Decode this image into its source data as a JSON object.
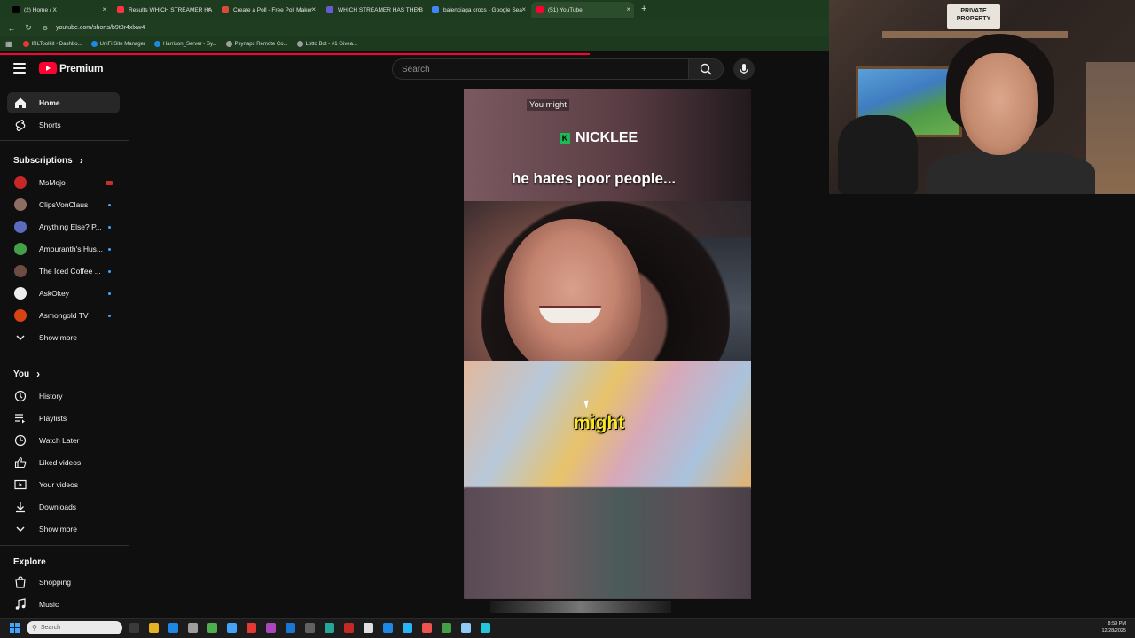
{
  "browser": {
    "tabs": [
      {
        "label": "(2) Home / X",
        "fav_color": "#000000",
        "active": false
      },
      {
        "label": "Results WHICH STREAMER HA",
        "fav_color": "#ff3344",
        "active": false
      },
      {
        "label": "Create a Poll - Free Poll Maker",
        "fav_color": "#d84c3a",
        "active": false
      },
      {
        "label": "WHICH STREAMER HAS THE B",
        "fav_color": "#6a5acd",
        "active": false
      },
      {
        "label": "balenciaga crocs - Google Sea",
        "fav_color": "#4285f4",
        "active": false
      },
      {
        "label": "(51) YouTube",
        "fav_color": "#ff0033",
        "active": true
      }
    ],
    "url": "youtube.com/shorts/b9t8r4xlxw4",
    "bookmarks": [
      {
        "label": "IRLToolkit • Dashbo...",
        "color": "#e53935"
      },
      {
        "label": "UniFi Site Manager",
        "color": "#1e88e5"
      },
      {
        "label": "Harrison_Server - Sy...",
        "color": "#1e88e5"
      },
      {
        "label": "Psynaps Remote Co...",
        "color": "#9e9e9e"
      },
      {
        "label": "Lotto Bot - #1 Givea...",
        "color": "#9e9e9e"
      }
    ],
    "accent": "#ff0033"
  },
  "header": {
    "logo_text": "Premium",
    "search_placeholder": "Search"
  },
  "sidebar": {
    "main": [
      {
        "label": "Home",
        "icon": "home-icon",
        "selected": true
      },
      {
        "label": "Shorts",
        "icon": "shorts-icon",
        "selected": false
      }
    ],
    "subscriptions_title": "Subscriptions",
    "subscriptions": [
      {
        "label": "MsMojo",
        "color": "#c62828",
        "badge": "live"
      },
      {
        "label": "ClipsVonClaus",
        "color": "#8d6e63",
        "badge": "dot"
      },
      {
        "label": "Anything Else? P...",
        "color": "#5c6bc0",
        "badge": "dot"
      },
      {
        "label": "Amouranth's Hus...",
        "color": "#43a047",
        "badge": "dot"
      },
      {
        "label": "The Iced Coffee ...",
        "color": "#6d4c41",
        "badge": "dot"
      },
      {
        "label": "AskOkey",
        "color": "#eeeeee",
        "badge": "dot"
      },
      {
        "label": "Asmongold TV",
        "color": "#d84315",
        "badge": "dot"
      }
    ],
    "show_more_1": "Show more",
    "you_title": "You",
    "you": [
      {
        "label": "History",
        "icon": "history-icon"
      },
      {
        "label": "Playlists",
        "icon": "playlists-icon"
      },
      {
        "label": "Watch Later",
        "icon": "watch-later-icon"
      },
      {
        "label": "Liked videos",
        "icon": "like-icon"
      },
      {
        "label": "Your videos",
        "icon": "your-videos-icon"
      },
      {
        "label": "Downloads",
        "icon": "download-icon"
      }
    ],
    "show_more_2": "Show more",
    "explore_title": "Explore",
    "explore": [
      {
        "label": "Shopping",
        "icon": "shopping-icon"
      },
      {
        "label": "Music",
        "icon": "music-icon"
      }
    ]
  },
  "video": {
    "caption_small": "You might",
    "caption_name": "NICKLEE",
    "caption_name_badge": "K",
    "caption_main": "he hates poor people...",
    "caption_yellow": "might"
  },
  "webcam": {
    "sign_text": "PRIVATE PROPERTY"
  },
  "taskbar": {
    "search_placeholder": "Search",
    "time": "8:59 PM",
    "date": "12/28/2025"
  }
}
